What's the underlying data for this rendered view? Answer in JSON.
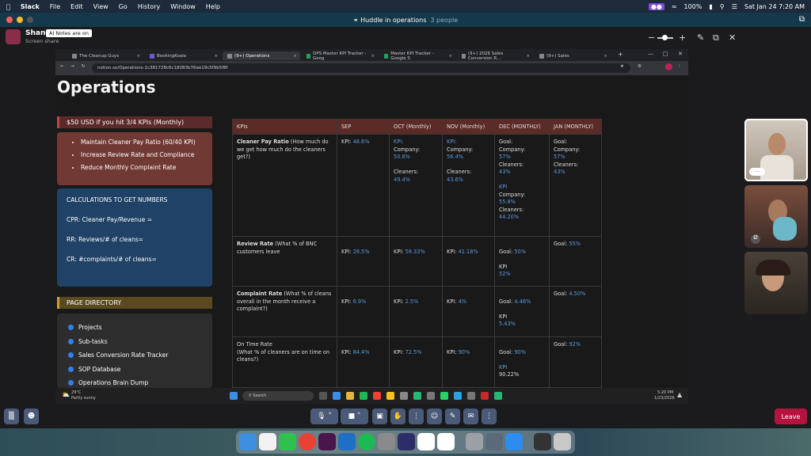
{
  "menubar": {
    "app": "Slack",
    "items": [
      "File",
      "Edit",
      "View",
      "Go",
      "History",
      "Window",
      "Help"
    ],
    "battery": "100%",
    "datetime": "Sat Jan 24  7:20 AM"
  },
  "huddle": {
    "title": "Huddle in operations",
    "people": "3 people"
  },
  "share": {
    "name": "Shane",
    "notes_badge": "AI Notes are on",
    "subtitle": "Screen share"
  },
  "browser": {
    "tabs": [
      {
        "label": "The Cleanup Guys"
      },
      {
        "label": "BookingKoala"
      },
      {
        "label": "(9+) Operations"
      },
      {
        "label": "OPS Master KPI Tracker - Goog"
      },
      {
        "label": "Master KPI Tracker - Google S"
      },
      {
        "label": "(9+) 2026 Sales Conversion R..."
      },
      {
        "label": "(9+) Sales"
      }
    ],
    "url": "notion.so/Operations-1c381728c6c18083b76ae19c5f9b5f8f"
  },
  "page": {
    "title": "Operations",
    "reward": "$50 USD if you hit 3/4 KPIs (Monthly)",
    "goals": [
      "Maintain Cleaner Pay Ratio (60/40 KPI)",
      "Increase Review Rate and Compliance",
      "Reduce Monthly Complaint Rate"
    ],
    "calc": {
      "heading": "CALCULATIONS TO GET NUMBERS",
      "lines": [
        "CPR: Cleaner Pay/Revenue =",
        "RR: Reviews/# of cleans=",
        "CR: #complaints/# of cleans="
      ]
    },
    "directory": {
      "heading": "PAGE DIRECTORY",
      "items": [
        "Projects",
        "Sub-tasks",
        "Sales Conversion Rate Tracker",
        "SOP Database",
        "Operations Brain Dump"
      ]
    },
    "table": {
      "headers": [
        "KPIs",
        "SEP",
        "OCT (Monthly)",
        "NOV (Monthly)",
        "DEC (MONTHLY)",
        "JAN (MONTHLY)"
      ],
      "rows": [
        {
          "name": "Cleaner Pay Ratio",
          "desc": " (How much do we get how much do the cleaners get?)",
          "sep_l": "KPI: ",
          "sep_v": "48.6%",
          "oct_a": "KPI:",
          "oct_b": "Company: ",
          "oct_v": "50.6%",
          "oct_c": "Cleaners:",
          "oct_cv": "49.4%",
          "nov_a": "KPI:",
          "nov_b": "Company:",
          "nov_v": "56.4%",
          "nov_c": "Cleaners:",
          "nov_cv": "43.6%",
          "dec_goal": "Goal:",
          "dec_co": "Company:",
          "dec_cov": "57%",
          "dec_cl": "Cleaners:",
          "dec_clv": "43%",
          "dec_kpi": "KPI",
          "dec_co2": "Company:",
          "dec_cov2": "55.8%",
          "dec_cl2": "Cleaners:",
          "dec_clv2": "44.20%",
          "jan_goal": "Goal:",
          "jan_co": "Company:",
          "jan_cov": "57%",
          "jan_cl": "Cleaners:",
          "jan_clv": "43%"
        },
        {
          "name": "Review Rate",
          "desc": " (What % of BNC customers leave",
          "sep_l": "KPI: ",
          "sep_v": "28.5%",
          "oct_l": "KPI: ",
          "oct_v": "58.33%",
          "nov_l": "KPI: ",
          "nov_v": "41.18%",
          "dec_l": "Goal: ",
          "dec_v": "50%",
          "dec_k": "KPI",
          "dec_kv": "52%",
          "jan_l": "Goal: ",
          "jan_v": "55%"
        },
        {
          "name": "Complaint Rate",
          "desc": " (What % of cleans overall in the month receive a complaint?)",
          "sep_l": "KPI: ",
          "sep_v": "6.9%",
          "oct_l": "KPI: ",
          "oct_v": "2.5%",
          "nov_l": "KPI: ",
          "nov_v": "4%",
          "dec_l": "Goal: ",
          "dec_v": "4.46%",
          "dec_k": "KPI",
          "dec_kv": "5.43%",
          "jan_l": "Goal: ",
          "jan_v": "4.50%"
        },
        {
          "name": "On Time Rate",
          "desc": "(What % of cleaners are on time on cleans?)",
          "sep_l": "KPI: ",
          "sep_v": "84.4%",
          "oct_l": "KPI: ",
          "oct_v": "72.5%",
          "nov_l": "KPI: ",
          "nov_v": "90%",
          "dec_l": "Goal: ",
          "dec_v": "90%",
          "dec_k": "KPI",
          "dec_kv": "90.22%",
          "jan_l": "Goal: ",
          "jan_v": "92%"
        }
      ]
    }
  },
  "winbar": {
    "weather_temp": "29°C",
    "weather_desc": "Partly sunny",
    "search": "Search",
    "time": "5:20 PM",
    "date": "1/23/2026"
  },
  "huddle_controls": {
    "leave": "Leave"
  },
  "colors": {
    "kpi_blue": "#5b9ae0",
    "leave": "#b5123e",
    "header_red": "#5c2b27"
  }
}
